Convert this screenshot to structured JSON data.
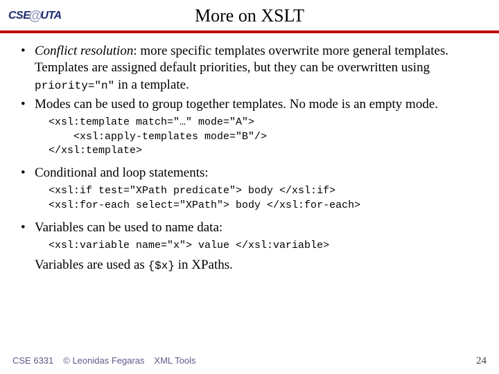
{
  "header": {
    "logo_left": "CSE",
    "logo_at": "@",
    "logo_right": "UTA",
    "title": "More on XSLT"
  },
  "bullets": [
    {
      "lead_italic": "Conflict resolution",
      "rest_before_code": ": more specific templates overwrite more general templates. Templates are assigned default priorities, but they can be overwritten using ",
      "inline_code": "priority=\"n\"",
      "rest_after_code": " in a template."
    },
    {
      "plain": "Modes can be used to group together templates. No mode is an empty mode."
    }
  ],
  "code_block_1": "<xsl:template match=\"…\" mode=\"A\">\n    <xsl:apply-templates mode=\"B\"/>\n</xsl:template>",
  "bullet3": "Conditional and loop statements:",
  "code_block_2": "<xsl:if test=\"XPath predicate\"> body </xsl:if>\n<xsl:for-each select=\"XPath\"> body </xsl:for-each>",
  "bullet4": "Variables can be used to name data:",
  "code_block_3": "<xsl:variable name=\"x\"> value </xsl:variable>",
  "closing": {
    "before": "Variables are used as ",
    "code": "{$x}",
    "after": " in XPaths."
  },
  "footer": {
    "course": "CSE 6331",
    "copyright": "© Leonidas Fegaras",
    "section": "XML Tools",
    "page": "24"
  }
}
